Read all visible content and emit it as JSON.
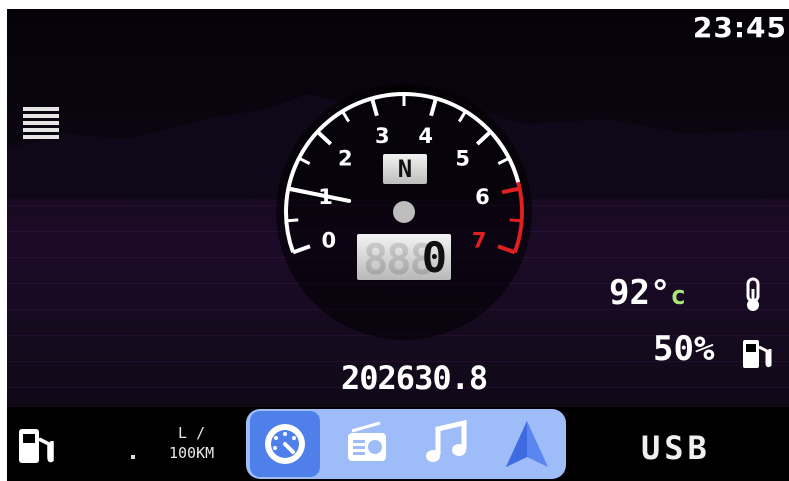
{
  "status": {
    "clock": "23:45"
  },
  "gauge": {
    "type": "tachometer",
    "tick_labels": [
      "0",
      "1",
      "2",
      "3",
      "4",
      "5",
      "6",
      "7"
    ],
    "redline_label": "7",
    "needle_value": 1,
    "gear": "N",
    "speed": "0",
    "speed_placeholder": "888"
  },
  "odometer": "202630.8",
  "engine": {
    "temp_value": "92°",
    "temp_unit": "c"
  },
  "fuel": {
    "level_text": "50%",
    "level_percent": 50
  },
  "bottom_bar": {
    "consumption_unit_top": "L /",
    "consumption_unit_bottom": "100KM",
    "consumption_value": ".",
    "source_label": "USB",
    "nav_items": [
      {
        "id": "dashboard",
        "icon": "speedometer-icon",
        "active": true
      },
      {
        "id": "radio",
        "icon": "radio-icon",
        "active": false
      },
      {
        "id": "music",
        "icon": "music-note-icon",
        "active": false
      },
      {
        "id": "navigation",
        "icon": "navigation-arrow-icon",
        "active": false
      }
    ]
  },
  "colors": {
    "nav_group_bg": "#9dbcf8",
    "nav_active_bg": "#4f7fe8",
    "redline": "#e02020",
    "temp_unit": "#a8e87a"
  }
}
